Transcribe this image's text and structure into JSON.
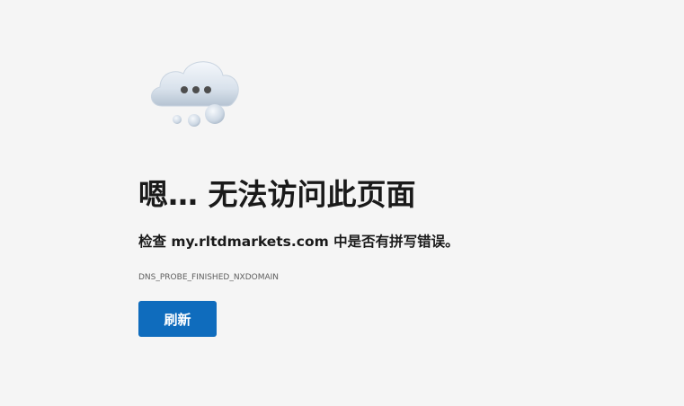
{
  "error": {
    "title": "嗯… 无法访问此页面",
    "message": "检查 my.rltdmarkets.com 中是否有拼写错误。",
    "code": "DNS_PROBE_FINISHED_NXDOMAIN",
    "illustration_icon": "thinking-cloud-icon"
  },
  "actions": {
    "refresh_label": "刷新"
  },
  "colors": {
    "background": "#f5f5f5",
    "button": "#0f6cbd",
    "title_text": "#1a1a1a",
    "code_text": "#5f5f5f"
  }
}
